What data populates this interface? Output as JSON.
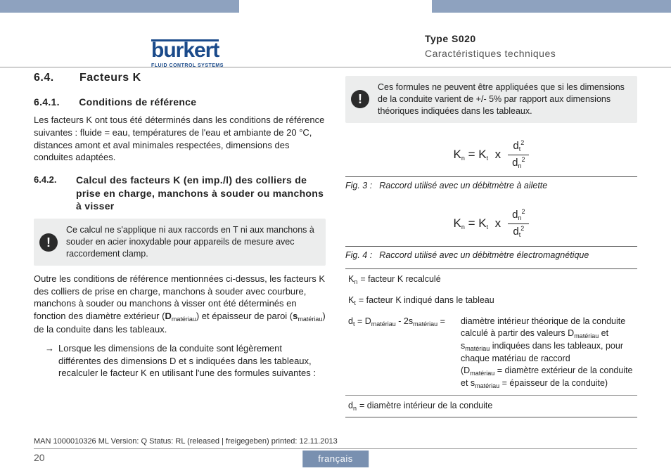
{
  "header": {
    "brand_name": "burkert",
    "brand_tagline": "FLUID CONTROL SYSTEMS",
    "type_label": "Type S020",
    "section_label": "Caractéristiques techniques"
  },
  "left": {
    "sec_num": "6.4.",
    "sec_title": "Facteurs K",
    "sub1_num": "6.4.1.",
    "sub1_title": "Conditions de référence",
    "sub1_para": "Les facteurs K ont tous été déterminés dans les conditions de référence suivantes : fluide = eau, températures de l'eau et ambiante de 20 °C, distances amont et aval minimales respectées, dimensions des conduites adaptées.",
    "sub2_num": "6.4.2.",
    "sub2_title": "Calcul des facteurs K (en imp./l) des colliers de prise en charge, manchons à souder ou manchons à visser",
    "note1": "Ce calcul ne s'applique ni aux raccords en T ni aux manchons à souder en acier inoxydable pour appareils de mesure avec raccordement clamp.",
    "para2a": "Outre les conditions de référence mentionnées ci-dessus, les facteurs K des colliers de prise en charge, manchons à souder avec courbure, manchons à souder ou manchons à visser ont été déterminés en fonction des diamètre extérieur (",
    "para2b": ") et épaisseur de paroi (",
    "para2c": ") de la conduite dans les tableaux.",
    "D_label": "D",
    "s_label": "s",
    "sub_mat": "matériau",
    "arrow": "→",
    "arrow_text": "Lorsque les dimensions de la conduite sont légèrement différentes des dimensions D et s indiquées dans les tableaux, recalculer le facteur K en utilisant l'une des formules suivantes :"
  },
  "right": {
    "note2": "Ces formules ne peuvent être appliquées que si les dimensions de la conduite varient de +/- 5% par rapport aux dimensions théoriques indiquées dans les tableaux.",
    "formula1": {
      "lhs": "K",
      "lhs_sub": "n",
      "eq1": "= K",
      "eq1_sub": "t",
      "times": "x",
      "top_base": "d",
      "top_sub": "t",
      "top_sup": "2",
      "bot_base": "d",
      "bot_sub": "n",
      "bot_sup": "2"
    },
    "fig3_label": "Fig. 3 :",
    "fig3_text": "Raccord utilisé avec un débitmètre à ailette",
    "formula2": {
      "lhs": "K",
      "lhs_sub": "n",
      "eq1": "= K",
      "eq1_sub": "t",
      "times": "x",
      "top_base": "d",
      "top_sub": "n",
      "top_sup": "2",
      "bot_base": "d",
      "bot_sub": "t",
      "bot_sup": "2"
    },
    "fig4_label": "Fig. 4 :",
    "fig4_text": "Raccord utilisé avec un débitmètre électromagnétique",
    "defs": {
      "kn_lhs": "K",
      "kn_sub": "n",
      "kn_rhs": " = facteur K recalculé",
      "kt_lhs": "K",
      "kt_sub": "t",
      "kt_rhs": " = facteur K indiqué dans le tableau",
      "dt_lhs_a": "d",
      "dt_lhs_a_sub": "t",
      "dt_lhs_b": " = D",
      "dt_lhs_b_sub": "matériau",
      "dt_lhs_c": " - 2s",
      "dt_lhs_c_sub": "matériau",
      "dt_lhs_d": " =",
      "dt_rhs1": "diamètre intérieur théorique de la conduite calculé à partir des valeurs D",
      "dt_rhs1_sub": "matériau",
      "dt_rhs2": " et s",
      "dt_rhs2_sub": "matériau",
      "dt_rhs3": " indiquées dans les tableaux, pour chaque matériau de raccord",
      "dt_rhs4a": "(D",
      "dt_rhs4a_sub": "matériau",
      "dt_rhs4b": " = diamètre extérieur de la conduite et s",
      "dt_rhs4b_sub": "matériau",
      "dt_rhs4c": " = épaisseur de la conduite)",
      "dn_lhs": "d",
      "dn_sub": "n",
      "dn_rhs": " = diamètre intérieur de la conduite"
    }
  },
  "footer": {
    "meta": "MAN  1000010326  ML  Version: Q Status: RL (released | freigegeben)  printed: 12.11.2013",
    "page": "20",
    "lang": "français"
  }
}
